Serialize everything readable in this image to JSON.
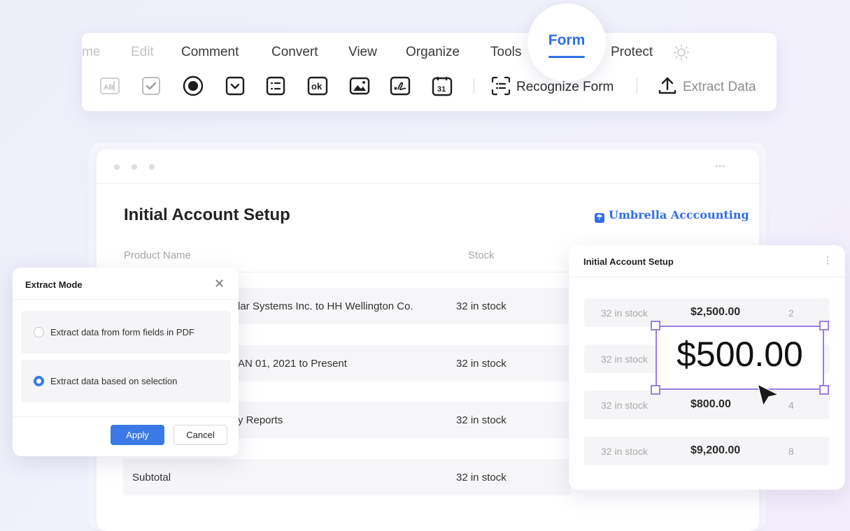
{
  "toolbar": {
    "menus": [
      "me",
      "Edit",
      "Comment",
      "Convert",
      "View",
      "Organize",
      "Tools",
      "Form",
      "Protect"
    ],
    "active_tab": "Form",
    "recognize_label": "Recognize Form",
    "extract_label": "Extract Data",
    "field_icons": [
      "text-field",
      "checkbox",
      "radio-button",
      "dropdown",
      "list-box",
      "ok-button",
      "image-field",
      "signature-field",
      "date-field"
    ],
    "ok_glyph": "ok",
    "date_glyph": "31",
    "text_field_glyph": "AB"
  },
  "card": {
    "title": "Initial Account Setup",
    "brand": "Umbrella Acccounting",
    "columns": {
      "product": "Product Name",
      "stock": "Stock"
    },
    "rows": [
      {
        "product": "lar Systems Inc. to HH Wellington Co.",
        "stock": "32 in stock"
      },
      {
        "product": "AN 01, 2021 to Present",
        "stock": "32 in stock"
      },
      {
        "product": "y Reports",
        "stock": "32 in stock"
      },
      {
        "product": "Subtotal",
        "stock": "32 in stock"
      }
    ]
  },
  "dialog": {
    "title": "Extract Mode",
    "options": [
      {
        "label": "Extract data from form fields in PDF",
        "selected": false
      },
      {
        "label": "Extract data based on selection",
        "selected": true
      }
    ],
    "apply": "Apply",
    "cancel": "Cancel"
  },
  "panel": {
    "title": "Initial Account Setup",
    "rows": [
      {
        "stock": "32 in stock",
        "price": "$2,500.00",
        "qty": "2"
      },
      {
        "stock": "32 in stock",
        "price": "",
        "qty": ""
      },
      {
        "stock": "32 in stock",
        "price": "$800.00",
        "qty": "4"
      },
      {
        "stock": "32 in stock",
        "price": "$9,200.00",
        "qty": "8"
      }
    ],
    "selection_value": "$500.00"
  },
  "colors": {
    "accent": "#2f6fe4",
    "selection": "#9a7de4",
    "button": "#3b7ae6"
  }
}
